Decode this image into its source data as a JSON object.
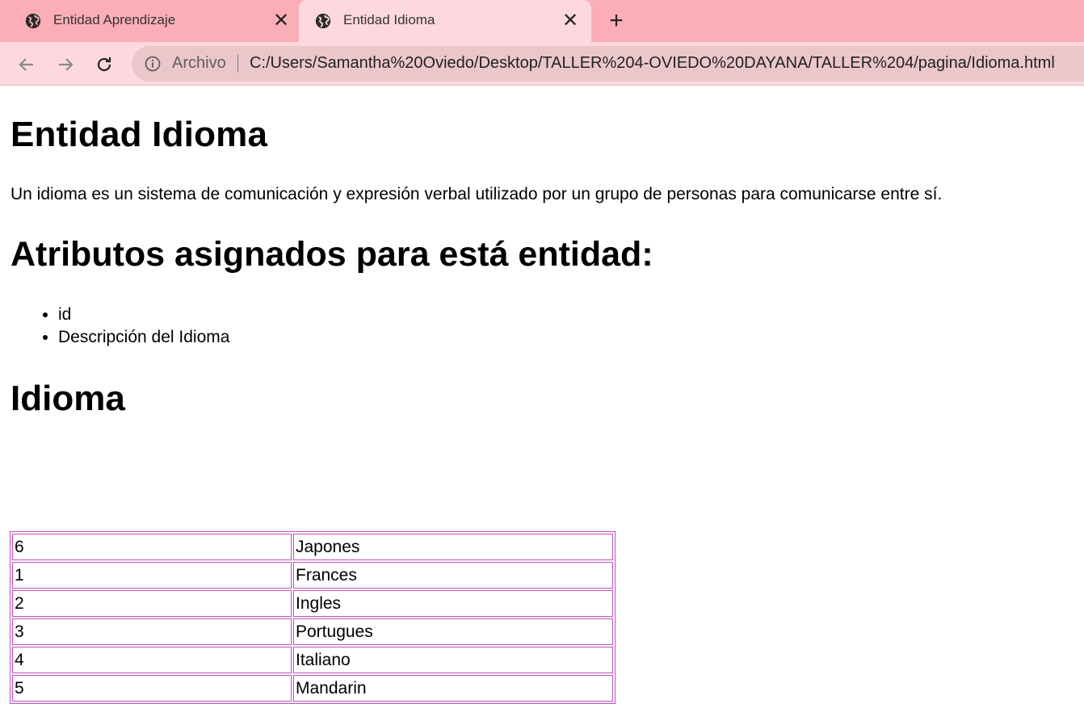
{
  "browser": {
    "tabs": [
      {
        "title": "Entidad Aprendizaje",
        "active": false
      },
      {
        "title": "Entidad Idioma",
        "active": true
      }
    ],
    "new_tab_label": "+",
    "close_label": "✕",
    "address": {
      "security_label": "Archivo",
      "url": "C:/Users/Samantha%20Oviedo/Desktop/TALLER%204-OVIEDO%20DAYANA/TALLER%204/pagina/Idioma.html"
    }
  },
  "page": {
    "title": "Entidad Idioma",
    "description": "Un idioma es un sistema de comunicación y expresión verbal utilizado por un grupo de personas para comunicarse entre sí.",
    "attributes_heading": "Atributos asignados para está entidad:",
    "attributes": [
      "id",
      "Descripción del Idioma"
    ],
    "table_heading": "Idioma",
    "table_rows": [
      [
        "6",
        "Japones"
      ],
      [
        "1",
        "Frances"
      ],
      [
        "2",
        "Ingles"
      ],
      [
        "3",
        "Portugues"
      ],
      [
        "4",
        "Italiano"
      ],
      [
        "5",
        "Mandarin"
      ]
    ]
  },
  "colors": {
    "tabstrip": "#fbaeb8",
    "toolbar": "#fdd9df",
    "omnibox": "#ebc7cc",
    "table_border": "#c050c0"
  },
  "icons": {
    "tab_favicon": "globe-icon",
    "back": "arrow-left-icon",
    "forward": "arrow-right-icon",
    "reload": "reload-icon",
    "site_info": "info-icon"
  }
}
